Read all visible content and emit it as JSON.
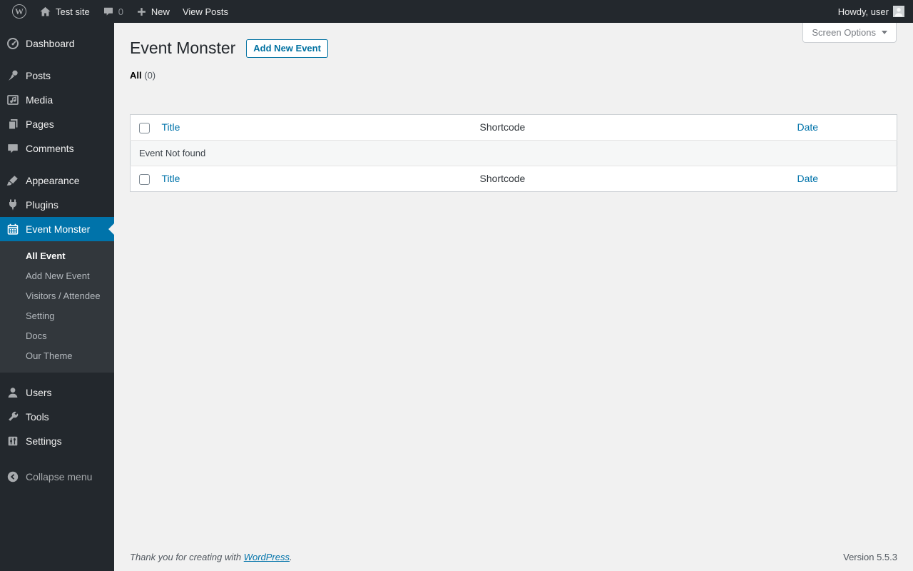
{
  "admin_bar": {
    "wp_logo": "W",
    "site_name": "Test site",
    "comment_count": "0",
    "new_label": "New",
    "view_posts_label": "View Posts",
    "howdy": "Howdy, user",
    "icons": [
      "wordpress-logo-icon",
      "home-icon",
      "comment-bubble-icon",
      "plus-icon",
      "avatar"
    ]
  },
  "sidebar": {
    "items": [
      {
        "label": "Dashboard",
        "icon": "dashboard-gauge-icon"
      },
      {
        "label": "Posts",
        "icon": "pushpin-icon"
      },
      {
        "label": "Media",
        "icon": "media-icon"
      },
      {
        "label": "Pages",
        "icon": "pages-icon"
      },
      {
        "label": "Comments",
        "icon": "comments-icon"
      },
      {
        "label": "Appearance",
        "icon": "appearance-brush-icon"
      },
      {
        "label": "Plugins",
        "icon": "plugin-icon"
      },
      {
        "label": "Event Monster",
        "icon": "calendar-icon",
        "active": true
      },
      {
        "label": "Users",
        "icon": "users-icon"
      },
      {
        "label": "Tools",
        "icon": "wrench-icon"
      },
      {
        "label": "Settings",
        "icon": "settings-sliders-icon"
      },
      {
        "label": "Collapse menu",
        "icon": "collapse-arrow-icon"
      }
    ],
    "event_monster_submenu": [
      "All Event",
      "Add New Event",
      "Visitors / Attendee",
      "Setting",
      "Docs",
      "Our Theme"
    ],
    "submenu_current": "All Event"
  },
  "page": {
    "title": "Event Monster",
    "add_new_label": "Add New Event",
    "screen_options_label": "Screen Options",
    "filter": {
      "all_label": "All",
      "all_count": "(0)"
    },
    "table": {
      "columns": [
        "Title",
        "Shortcode",
        "Date"
      ],
      "empty_message": "Event Not found"
    }
  },
  "footer": {
    "thanks_prefix": "Thank you for creating with ",
    "wordpress_link": "WordPress",
    "thanks_suffix": ".",
    "version": "Version 5.5.3"
  },
  "colors": {
    "admin_bar_bg": "#23282d",
    "menu_bg": "#23282d",
    "submenu_bg": "#32373c",
    "active_menu_blue": "#0073aa",
    "content_bg": "#f1f1f1",
    "link_blue": "#0073aa",
    "button_blue": "#0071a1"
  }
}
